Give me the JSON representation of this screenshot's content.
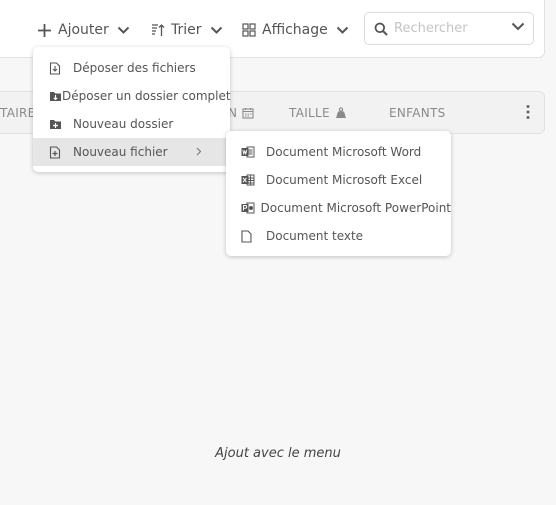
{
  "toolbar": {
    "add_label": "Ajouter",
    "sort_label": "Trier",
    "view_label": "Affichage",
    "search_placeholder": "Rechercher"
  },
  "table_header": {
    "owner": "TAIRE",
    "modified": "N",
    "size": "TAILLE",
    "children": "ENFANTS"
  },
  "add_menu": {
    "items": [
      {
        "label": "Déposer des fichiers",
        "icon": "file-upload-icon"
      },
      {
        "label": "Déposer un dossier complet",
        "icon": "folder-upload-icon"
      },
      {
        "label": "Nouveau dossier",
        "icon": "folder-add-icon"
      },
      {
        "label": "Nouveau fichier",
        "icon": "file-add-icon",
        "active": true
      }
    ]
  },
  "new_file_menu": {
    "items": [
      {
        "label": "Document Microsoft Word",
        "icon": "word-icon"
      },
      {
        "label": "Document Microsoft Excel",
        "icon": "excel-icon"
      },
      {
        "label": "Document Microsoft PowerPoint",
        "icon": "powerpoint-icon"
      },
      {
        "label": "Document texte",
        "icon": "text-file-icon"
      }
    ]
  },
  "empty_message": "Ajout avec le menu",
  "colors": {
    "text": "#555555",
    "muted": "#8a8a8a",
    "active_item": "#e6e6e6",
    "background": "#f7f7f7"
  }
}
